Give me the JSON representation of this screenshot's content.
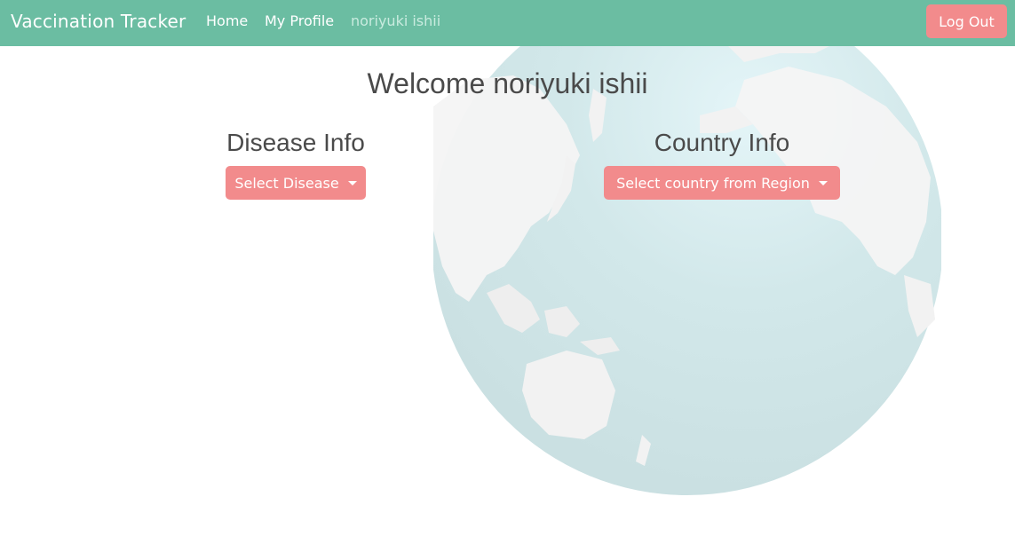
{
  "navbar": {
    "brand": "Vaccination Tracker",
    "links": [
      "Home",
      "My Profile"
    ],
    "username": "noriyuki ishii",
    "logout_label": "Log Out",
    "bg_color": "#6bbda2"
  },
  "main": {
    "welcome": "Welcome noriyuki ishii",
    "disease": {
      "title": "Disease Info",
      "button_label": "Select Disease"
    },
    "country": {
      "title": "Country Info",
      "button_label": "Select country from Region"
    },
    "button_color": "#f28b8c"
  },
  "background": {
    "image": "globe-icon"
  }
}
